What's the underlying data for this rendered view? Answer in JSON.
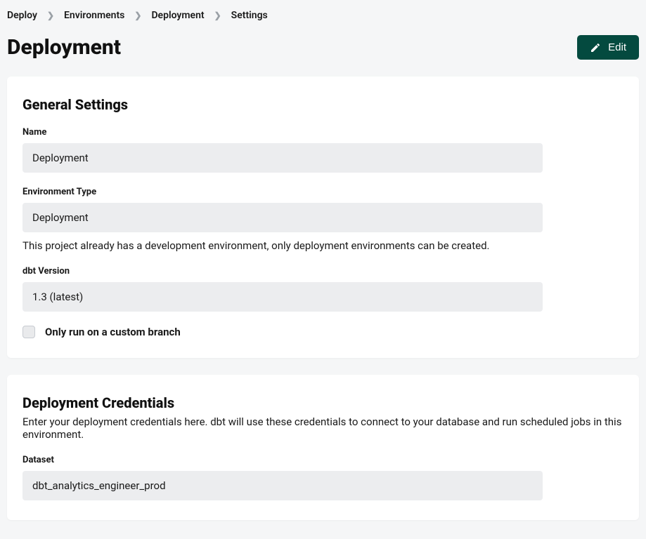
{
  "breadcrumb": {
    "items": [
      "Deploy",
      "Environments",
      "Deployment",
      "Settings"
    ]
  },
  "page": {
    "title": "Deployment",
    "edit_label": "Edit"
  },
  "general": {
    "heading": "General Settings",
    "name_label": "Name",
    "name_value": "Deployment",
    "env_type_label": "Environment Type",
    "env_type_value": "Deployment",
    "env_type_help": "This project already has a development environment, only deployment environments can be created.",
    "dbt_version_label": "dbt Version",
    "dbt_version_value": "1.3 (latest)",
    "custom_branch_label": "Only run on a custom branch"
  },
  "credentials": {
    "heading": "Deployment Credentials",
    "description": "Enter your deployment credentials here. dbt will use these credentials to connect to your database and run scheduled jobs in this environment.",
    "dataset_label": "Dataset",
    "dataset_value": "dbt_analytics_engineer_prod"
  }
}
